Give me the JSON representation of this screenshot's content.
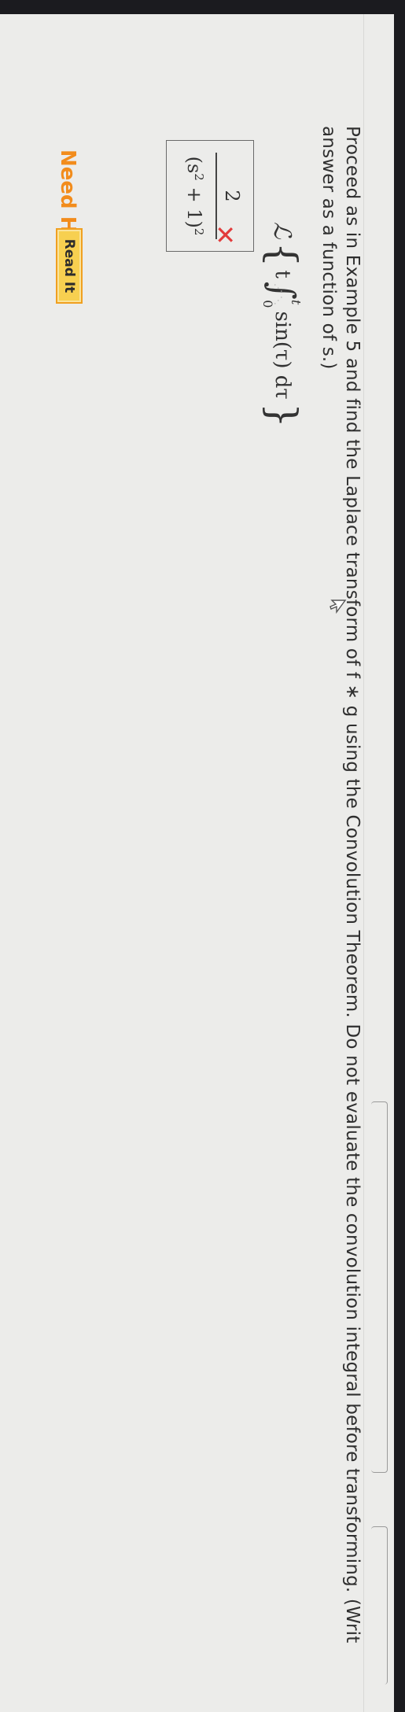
{
  "question": {
    "text": "Proceed as in Example 5 and find the Laplace transform of f * g using the Convolution Theorem. Do not evaluate the convolution integral before transforming. (Write your answer as a function of s.)",
    "visible_text": "Proceed as in Example 5 and find the Laplace transform of f ∗ g using the Convolution Theorem. Do not evaluate the convolution integral before transforming. (Writ answer as a function of s.)"
  },
  "expression": {
    "operator": "ℒ",
    "variable": "t",
    "upper_limit": "t",
    "lower_limit": "0",
    "integrand": "sin(τ) dτ"
  },
  "answer": {
    "numerator": "2",
    "denominator_base": "s",
    "denominator_exp": "2",
    "denominator_rest": "+ 1",
    "outer_exp": "2",
    "status_mark": "✕"
  },
  "help": {
    "label": "Need Help?",
    "button": "Read It"
  },
  "colors": {
    "incorrect": "#e23b3b",
    "help_label": "#f28c1c",
    "button_bg": "#f7d050"
  }
}
